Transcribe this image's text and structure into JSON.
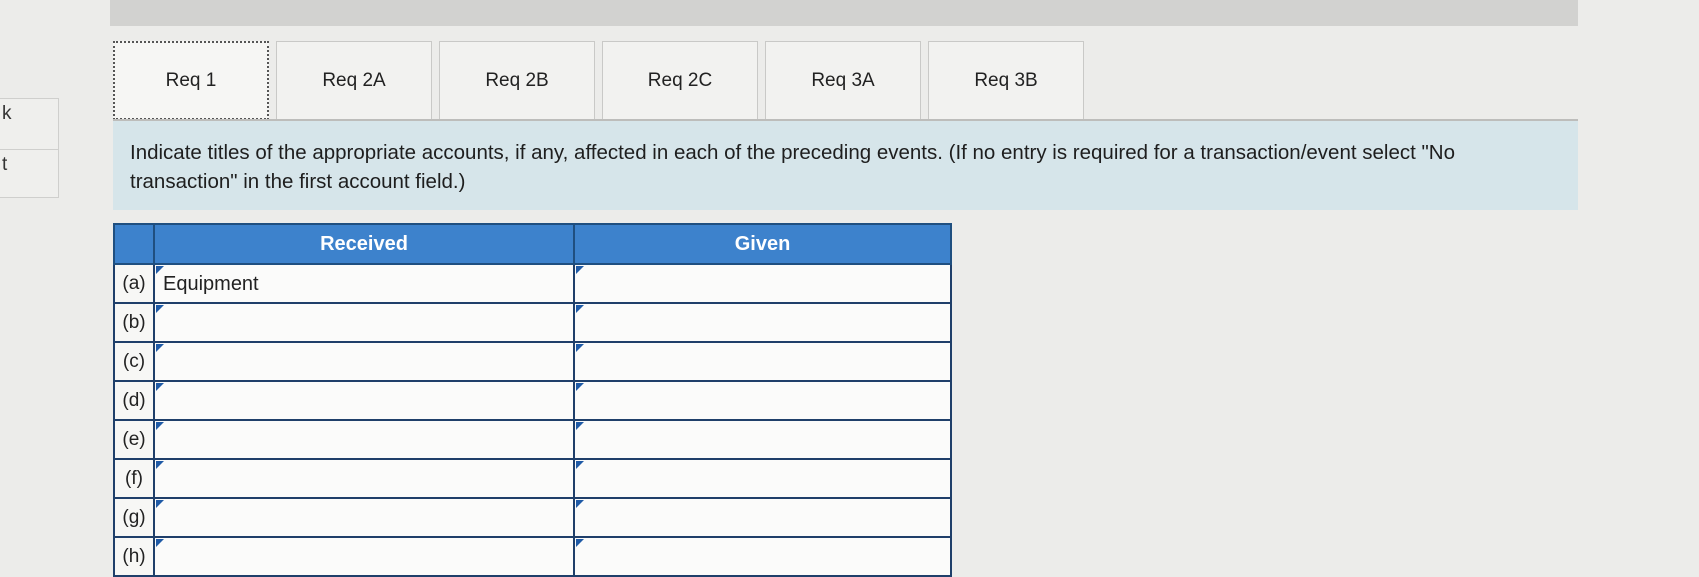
{
  "left_edge": {
    "line1": "k",
    "line2": "t"
  },
  "tabs": [
    {
      "label": "Req 1",
      "active": true
    },
    {
      "label": "Req 2A",
      "active": false
    },
    {
      "label": "Req 2B",
      "active": false
    },
    {
      "label": "Req 2C",
      "active": false
    },
    {
      "label": "Req 3A",
      "active": false
    },
    {
      "label": "Req 3B",
      "active": false
    }
  ],
  "instructions": "Indicate titles of the appropriate accounts, if any, affected in each of the preceding events. (If no entry is required for a transaction/event select \"No transaction\" in the first account field.)",
  "table": {
    "headers": {
      "received": "Received",
      "given": "Given"
    },
    "rows": [
      {
        "label": "(a)",
        "received": "Equipment",
        "given": ""
      },
      {
        "label": "(b)",
        "received": "",
        "given": ""
      },
      {
        "label": "(c)",
        "received": "",
        "given": ""
      },
      {
        "label": "(d)",
        "received": "",
        "given": ""
      },
      {
        "label": "(e)",
        "received": "",
        "given": ""
      },
      {
        "label": "(f)",
        "received": "",
        "given": ""
      },
      {
        "label": "(g)",
        "received": "",
        "given": ""
      },
      {
        "label": "(h)",
        "received": "",
        "given": ""
      }
    ]
  }
}
